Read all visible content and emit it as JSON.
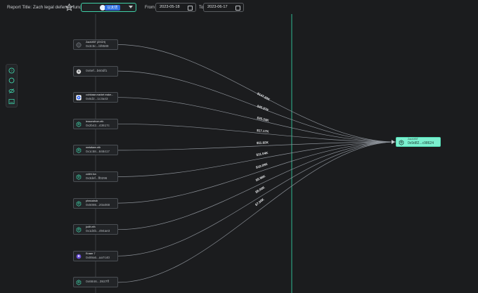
{
  "header": {
    "report_label": "Report Title:",
    "report_title": "Zach legal defense fund",
    "chain_pill": "以太坊",
    "from_label": "From",
    "from_date": "2023-05-18",
    "to_label": "To",
    "to_date": "2023-06-17"
  },
  "toolbar": {
    "icons": [
      "help-circle-icon",
      "circle-icon",
      "eye-off-icon",
      "image-icon"
    ]
  },
  "sources": [
    {
      "name": "ZachXBT (ZXCH)",
      "address": "0x3c5c...bf8589",
      "icon": "zachxbt-token-icon",
      "amount": "$147.33K"
    },
    {
      "name": "",
      "address": "0x6ef...b60df1",
      "icon": "ether-icon",
      "amount": "$45.97K"
    },
    {
      "name": "coinbase.market make...",
      "address": "0x6d2...1c3a43",
      "icon": "coinbase-icon",
      "amount": "$35.33K"
    },
    {
      "name": "lessonsfrom.eth",
      "address": "0x2b42...43617c",
      "icon": "ens-account-icon",
      "amount": "$17.17K"
    },
    {
      "name": "metafarm.eth",
      "address": "0x1c58...848417",
      "icon": "ens-account-icon",
      "amount": "$11.92K"
    },
    {
      "name": "zoltrh.fun",
      "address": "0x3def...ff0296",
      "icon": "ens-account-icon",
      "amount": "$11.04K"
    },
    {
      "name": "phmcatrub",
      "address": "0x5086...20a068",
      "icon": "ens-account-icon",
      "amount": "$10.09K"
    },
    {
      "name": "jodih.eth",
      "address": "0x1d4b...494ae3",
      "icon": "ens-account-icon",
      "amount": "$9.98K"
    },
    {
      "name": "Eraser 7",
      "address": "0x89a6...aa7c40",
      "icon": "eraser-avatar-icon",
      "amount": "$8.00K"
    },
    {
      "name": "",
      "address": "0x6846...3927ff",
      "icon": "ens-account-icon",
      "amount": "$7.00K"
    }
  ],
  "target": {
    "name": "ZachXBT",
    "address": "0x9d82...c98624",
    "icon": "ens-account-icon"
  },
  "colors": {
    "accent": "#3fd0a7",
    "target_fill": "#7bf0cf",
    "edge": "#8a8f96",
    "background": "#1b1c1e"
  }
}
